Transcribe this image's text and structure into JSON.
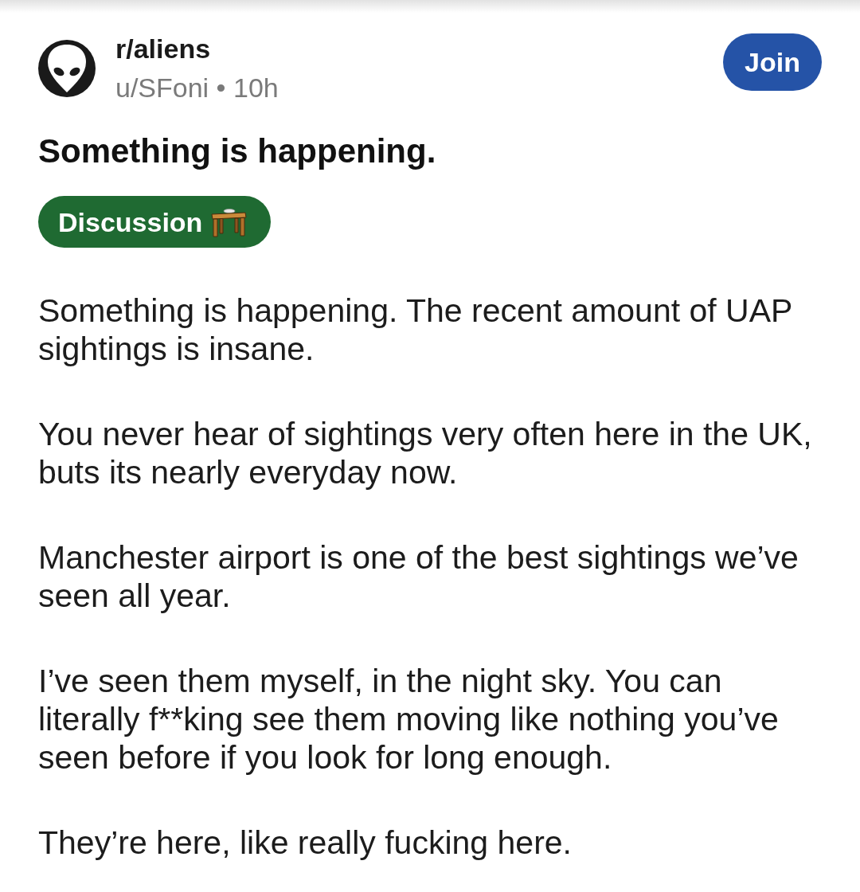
{
  "header": {
    "community": "r/aliens",
    "meta": "u/SFoni • 10h",
    "join_button": "Join"
  },
  "post": {
    "title": "Something is happening.",
    "flair": "Discussion",
    "body": [
      "Something is happening. The recent amount of UAP sightings is insane.",
      "You never hear of sightings very often here in the UK, buts its nearly everyday now.",
      "Manchester airport is one of the best sightings we’ve seen all year.",
      "I’ve seen them myself, in the night sky. You can literally f**king see them moving like nothing you’ve seen before if you look for long enough.",
      "They’re here, like really fucking here."
    ]
  }
}
